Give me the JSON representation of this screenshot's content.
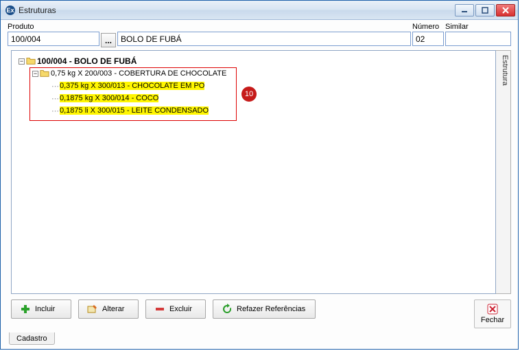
{
  "window": {
    "title": "Estruturas"
  },
  "fields": {
    "produto_label": "Produto",
    "produto_code": "100/004",
    "produto_desc": "BOLO DE FUBÁ",
    "numero_label": "Número",
    "numero_value": "02",
    "similar_label": "Similar",
    "similar_value": ""
  },
  "tree": {
    "root_label": "100/004 - BOLO DE FUBÁ",
    "level1_label": "0,75 kg X 200/003 - COBERTURA DE CHOCOLATE",
    "leaf1": "0,375 kg X 300/013 - CHOCOLATE EM PO",
    "leaf2": "0,1875 kg X 300/014 - COCO",
    "leaf3": "0,1875 li X 300/015 - LEITE CONDENSADO"
  },
  "side_tab": "Estrutura",
  "buttons": {
    "incluir": "Incluir",
    "alterar": "Alterar",
    "excluir": "Excluir",
    "refazer": "Refazer Referências",
    "fechar": "Fechar"
  },
  "bottom_tab": "Cadastro",
  "annot_number": "10"
}
